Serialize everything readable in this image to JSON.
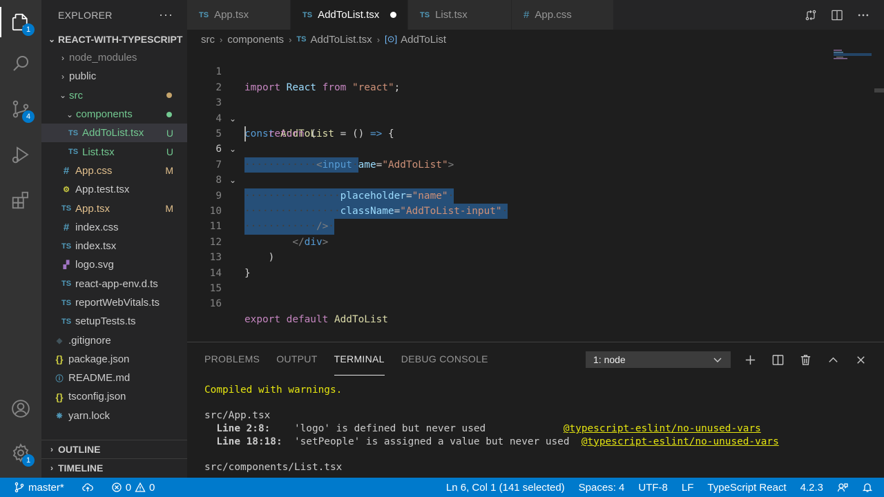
{
  "activity_bar": {
    "explorer_badge": "1",
    "scm_badge": "4",
    "settings_badge": "1"
  },
  "sidebar": {
    "title": "EXPLORER",
    "more_label": "···",
    "root_folder": "REACT-WITH-TYPESCRIPT",
    "tree": [
      {
        "label": "node_modules",
        "kind": "folder",
        "state": "collapsed",
        "status": ""
      },
      {
        "label": "public",
        "kind": "folder",
        "state": "collapsed",
        "status": ""
      },
      {
        "label": "src",
        "kind": "folder",
        "state": "expanded",
        "status": ""
      },
      {
        "label": "components",
        "kind": "folder",
        "state": "expanded",
        "status": ""
      },
      {
        "label": "AddToList.tsx",
        "kind": "ts",
        "status": "U"
      },
      {
        "label": "List.tsx",
        "kind": "ts",
        "status": "U"
      },
      {
        "label": "App.css",
        "kind": "css",
        "status": "M"
      },
      {
        "label": "App.test.tsx",
        "kind": "test",
        "status": ""
      },
      {
        "label": "App.tsx",
        "kind": "ts",
        "status": "M"
      },
      {
        "label": "index.css",
        "kind": "css",
        "status": ""
      },
      {
        "label": "index.tsx",
        "kind": "ts",
        "status": ""
      },
      {
        "label": "logo.svg",
        "kind": "svg",
        "status": ""
      },
      {
        "label": "react-app-env.d.ts",
        "kind": "ts",
        "status": ""
      },
      {
        "label": "reportWebVitals.ts",
        "kind": "ts",
        "status": ""
      },
      {
        "label": "setupTests.ts",
        "kind": "ts",
        "status": ""
      },
      {
        "label": ".gitignore",
        "kind": "git",
        "status": ""
      },
      {
        "label": "package.json",
        "kind": "json",
        "status": ""
      },
      {
        "label": "README.md",
        "kind": "info",
        "status": ""
      },
      {
        "label": "tsconfig.json",
        "kind": "json",
        "status": ""
      },
      {
        "label": "yarn.lock",
        "kind": "lock",
        "status": ""
      }
    ],
    "outline_label": "OUTLINE",
    "timeline_label": "TIMELINE"
  },
  "tabs": [
    {
      "label": "App.tsx",
      "icon": "TS",
      "active": false
    },
    {
      "label": "AddToList.tsx",
      "icon": "TS",
      "active": true,
      "dirty": true
    },
    {
      "label": "List.tsx",
      "icon": "TS",
      "active": false
    },
    {
      "label": "App.css",
      "icon": "#",
      "active": false
    }
  ],
  "breadcrumb": {
    "parts": [
      "src",
      "components"
    ],
    "file_icon": "TS",
    "file": "AddToList.tsx",
    "symbol": "AddToList"
  },
  "editor": {
    "line_numbers": [
      "1",
      "2",
      "3",
      "4",
      "5",
      "6",
      "7",
      "8",
      "9",
      "10",
      "11",
      "12",
      "13",
      "14",
      "15",
      "16"
    ],
    "current_line": 6
  },
  "panel": {
    "tabs": [
      "PROBLEMS",
      "OUTPUT",
      "TERMINAL",
      "DEBUG CONSOLE"
    ],
    "active_tab": "TERMINAL",
    "terminal_select": "1: node",
    "terminal": {
      "compiled": "Compiled with warnings.",
      "file1": "src/App.tsx",
      "w1_loc": "Line 2:8:",
      "w1_msg": "'logo' is defined but never used",
      "w1_rule": "@typescript-eslint/no-unused-vars",
      "w2_loc": "Line 18:18:",
      "w2_msg": "'setPeople' is assigned a value but never used",
      "w2_rule": "@typescript-eslint/no-unused-vars",
      "file2": "src/components/List.tsx"
    }
  },
  "statusbar": {
    "branch": "master*",
    "errors": "0",
    "warnings": "0",
    "position": "Ln 6, Col 1 (141 selected)",
    "spaces": "Spaces: 4",
    "encoding": "UTF-8",
    "eol": "LF",
    "language": "TypeScript React",
    "ts_version": "4.2.3"
  },
  "colors": {
    "accent": "#007acc",
    "selection": "#264f78",
    "untracked": "#73c991",
    "modified": "#e2c08d"
  }
}
